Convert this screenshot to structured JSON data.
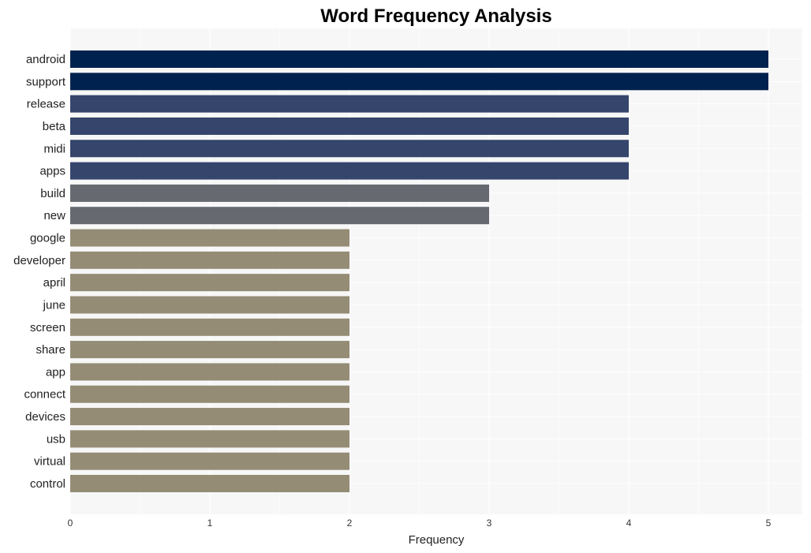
{
  "chart_data": {
    "type": "bar",
    "orientation": "horizontal",
    "title": "Word Frequency Analysis",
    "xlabel": "Frequency",
    "ylabel": "",
    "xlim": [
      0,
      5.25
    ],
    "xticks": [
      0,
      1,
      2,
      3,
      4,
      5
    ],
    "grid": true,
    "categories": [
      "android",
      "support",
      "release",
      "beta",
      "midi",
      "apps",
      "build",
      "new",
      "google",
      "developer",
      "april",
      "june",
      "screen",
      "share",
      "app",
      "connect",
      "devices",
      "usb",
      "virtual",
      "control"
    ],
    "values": [
      5,
      5,
      4,
      4,
      4,
      4,
      3,
      3,
      2,
      2,
      2,
      2,
      2,
      2,
      2,
      2,
      2,
      2,
      2,
      2
    ],
    "colors_by_value": {
      "5": "#00224e",
      "4": "#35456c",
      "3": "#666970",
      "2": "#948c75"
    },
    "plot_background": "#f7f7f7",
    "grid_color": "#ffffff"
  }
}
